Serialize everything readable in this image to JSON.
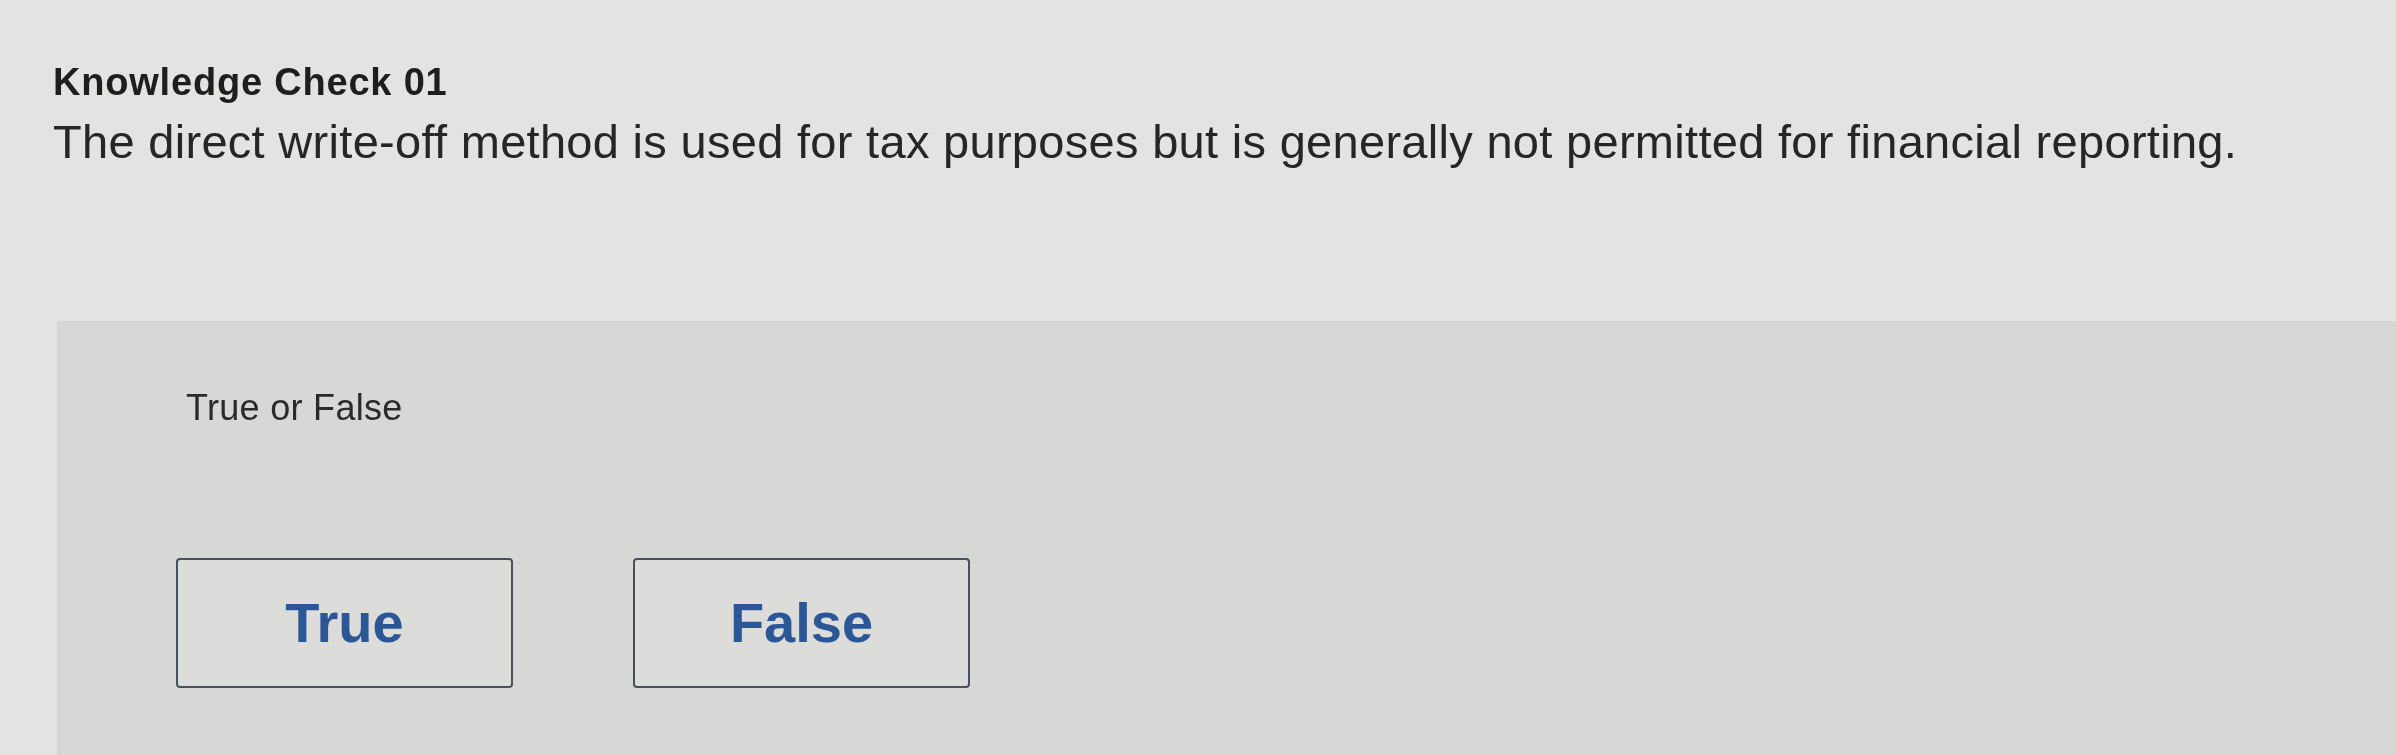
{
  "header": {
    "title": "Knowledge Check 01",
    "question": "The direct write-off method is used for tax purposes but is generally not permitted for financial reporting."
  },
  "answer_panel": {
    "prompt": "True or False",
    "choices": [
      {
        "label": "True",
        "selected": false
      },
      {
        "label": "False",
        "selected": false
      }
    ]
  }
}
